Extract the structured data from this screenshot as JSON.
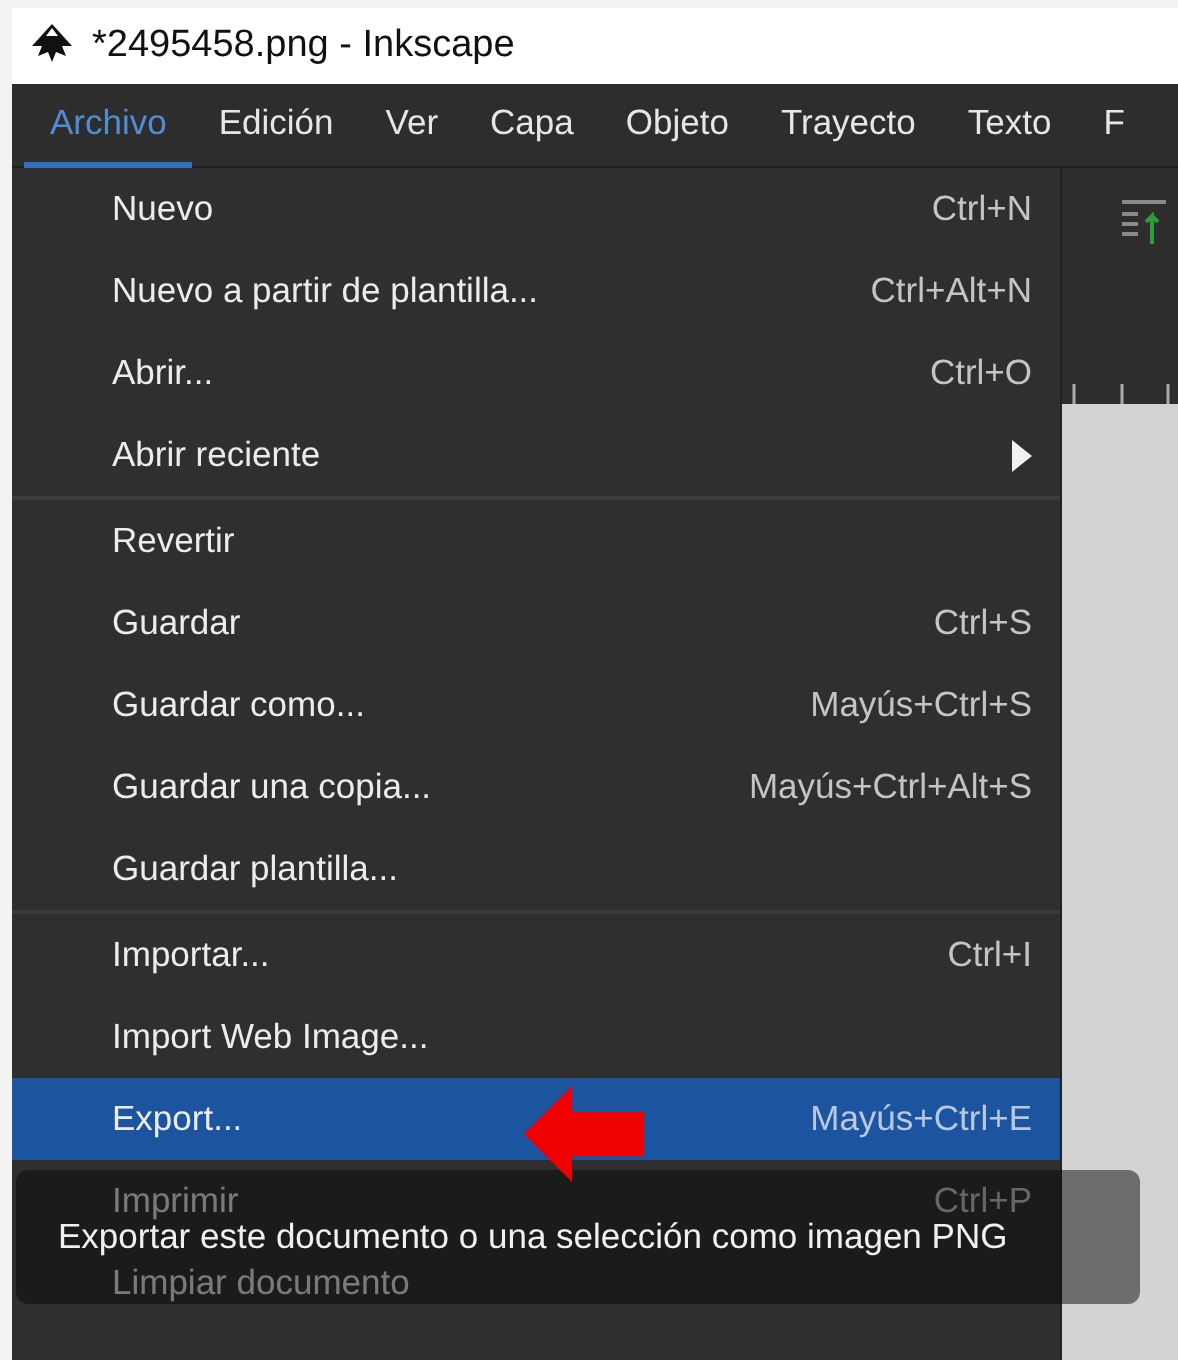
{
  "window": {
    "title": "*2495458.png - Inkscape"
  },
  "menubar": [
    {
      "label": "Archivo",
      "selected": true
    },
    {
      "label": "Edición",
      "selected": false
    },
    {
      "label": "Ver",
      "selected": false
    },
    {
      "label": "Capa",
      "selected": false
    },
    {
      "label": "Objeto",
      "selected": false
    },
    {
      "label": "Trayecto",
      "selected": false
    },
    {
      "label": "Texto",
      "selected": false
    },
    {
      "label": "F",
      "selected": false
    }
  ],
  "menu": [
    {
      "kind": "item",
      "label": "Nuevo",
      "shortcut": "Ctrl+N",
      "selected": false
    },
    {
      "kind": "item",
      "label": "Nuevo a partir de plantilla...",
      "shortcut": "Ctrl+Alt+N",
      "selected": false
    },
    {
      "kind": "item",
      "label": "Abrir...",
      "shortcut": "Ctrl+O",
      "selected": false
    },
    {
      "kind": "submenu",
      "label": "Abrir reciente",
      "selected": false
    },
    {
      "kind": "separator"
    },
    {
      "kind": "item",
      "label": "Revertir",
      "selected": false
    },
    {
      "kind": "item",
      "label": "Guardar",
      "shortcut": "Ctrl+S",
      "selected": false
    },
    {
      "kind": "item",
      "label": "Guardar como...",
      "shortcut": "Mayús+Ctrl+S",
      "selected": false
    },
    {
      "kind": "item",
      "label": "Guardar una copia...",
      "shortcut": "Mayús+Ctrl+Alt+S",
      "selected": false
    },
    {
      "kind": "item",
      "label": "Guardar plantilla...",
      "selected": false
    },
    {
      "kind": "separator"
    },
    {
      "kind": "item",
      "label": "Importar...",
      "shortcut": "Ctrl+I",
      "selected": false
    },
    {
      "kind": "item",
      "label": "Import Web Image...",
      "selected": false
    },
    {
      "kind": "item",
      "label": "Export...",
      "shortcut": "Mayús+Ctrl+E",
      "selected": true
    },
    {
      "kind": "item",
      "label": "Imprimir",
      "shortcut": "Ctrl+P",
      "selected": false
    },
    {
      "kind": "item",
      "label": "Limpiar documento",
      "selected": false
    }
  ],
  "tooltip": {
    "text": "Exportar este documento o una selección como imagen PNG"
  }
}
